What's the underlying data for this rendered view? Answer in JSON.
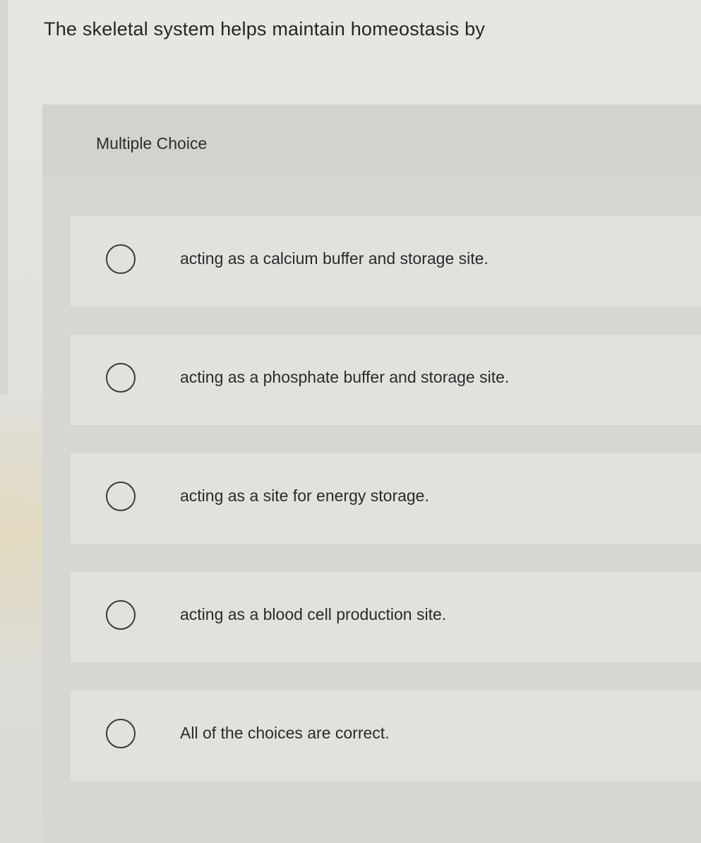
{
  "question": {
    "text": "The skeletal system helps maintain homeostasis by"
  },
  "panel": {
    "label": "Multiple Choice"
  },
  "options": [
    {
      "text": "acting as a calcium buffer and storage site."
    },
    {
      "text": "acting as a phosphate buffer and storage site."
    },
    {
      "text": "acting as a site for energy storage."
    },
    {
      "text": "acting as a blood cell production site."
    },
    {
      "text": "All of the choices are correct."
    }
  ]
}
